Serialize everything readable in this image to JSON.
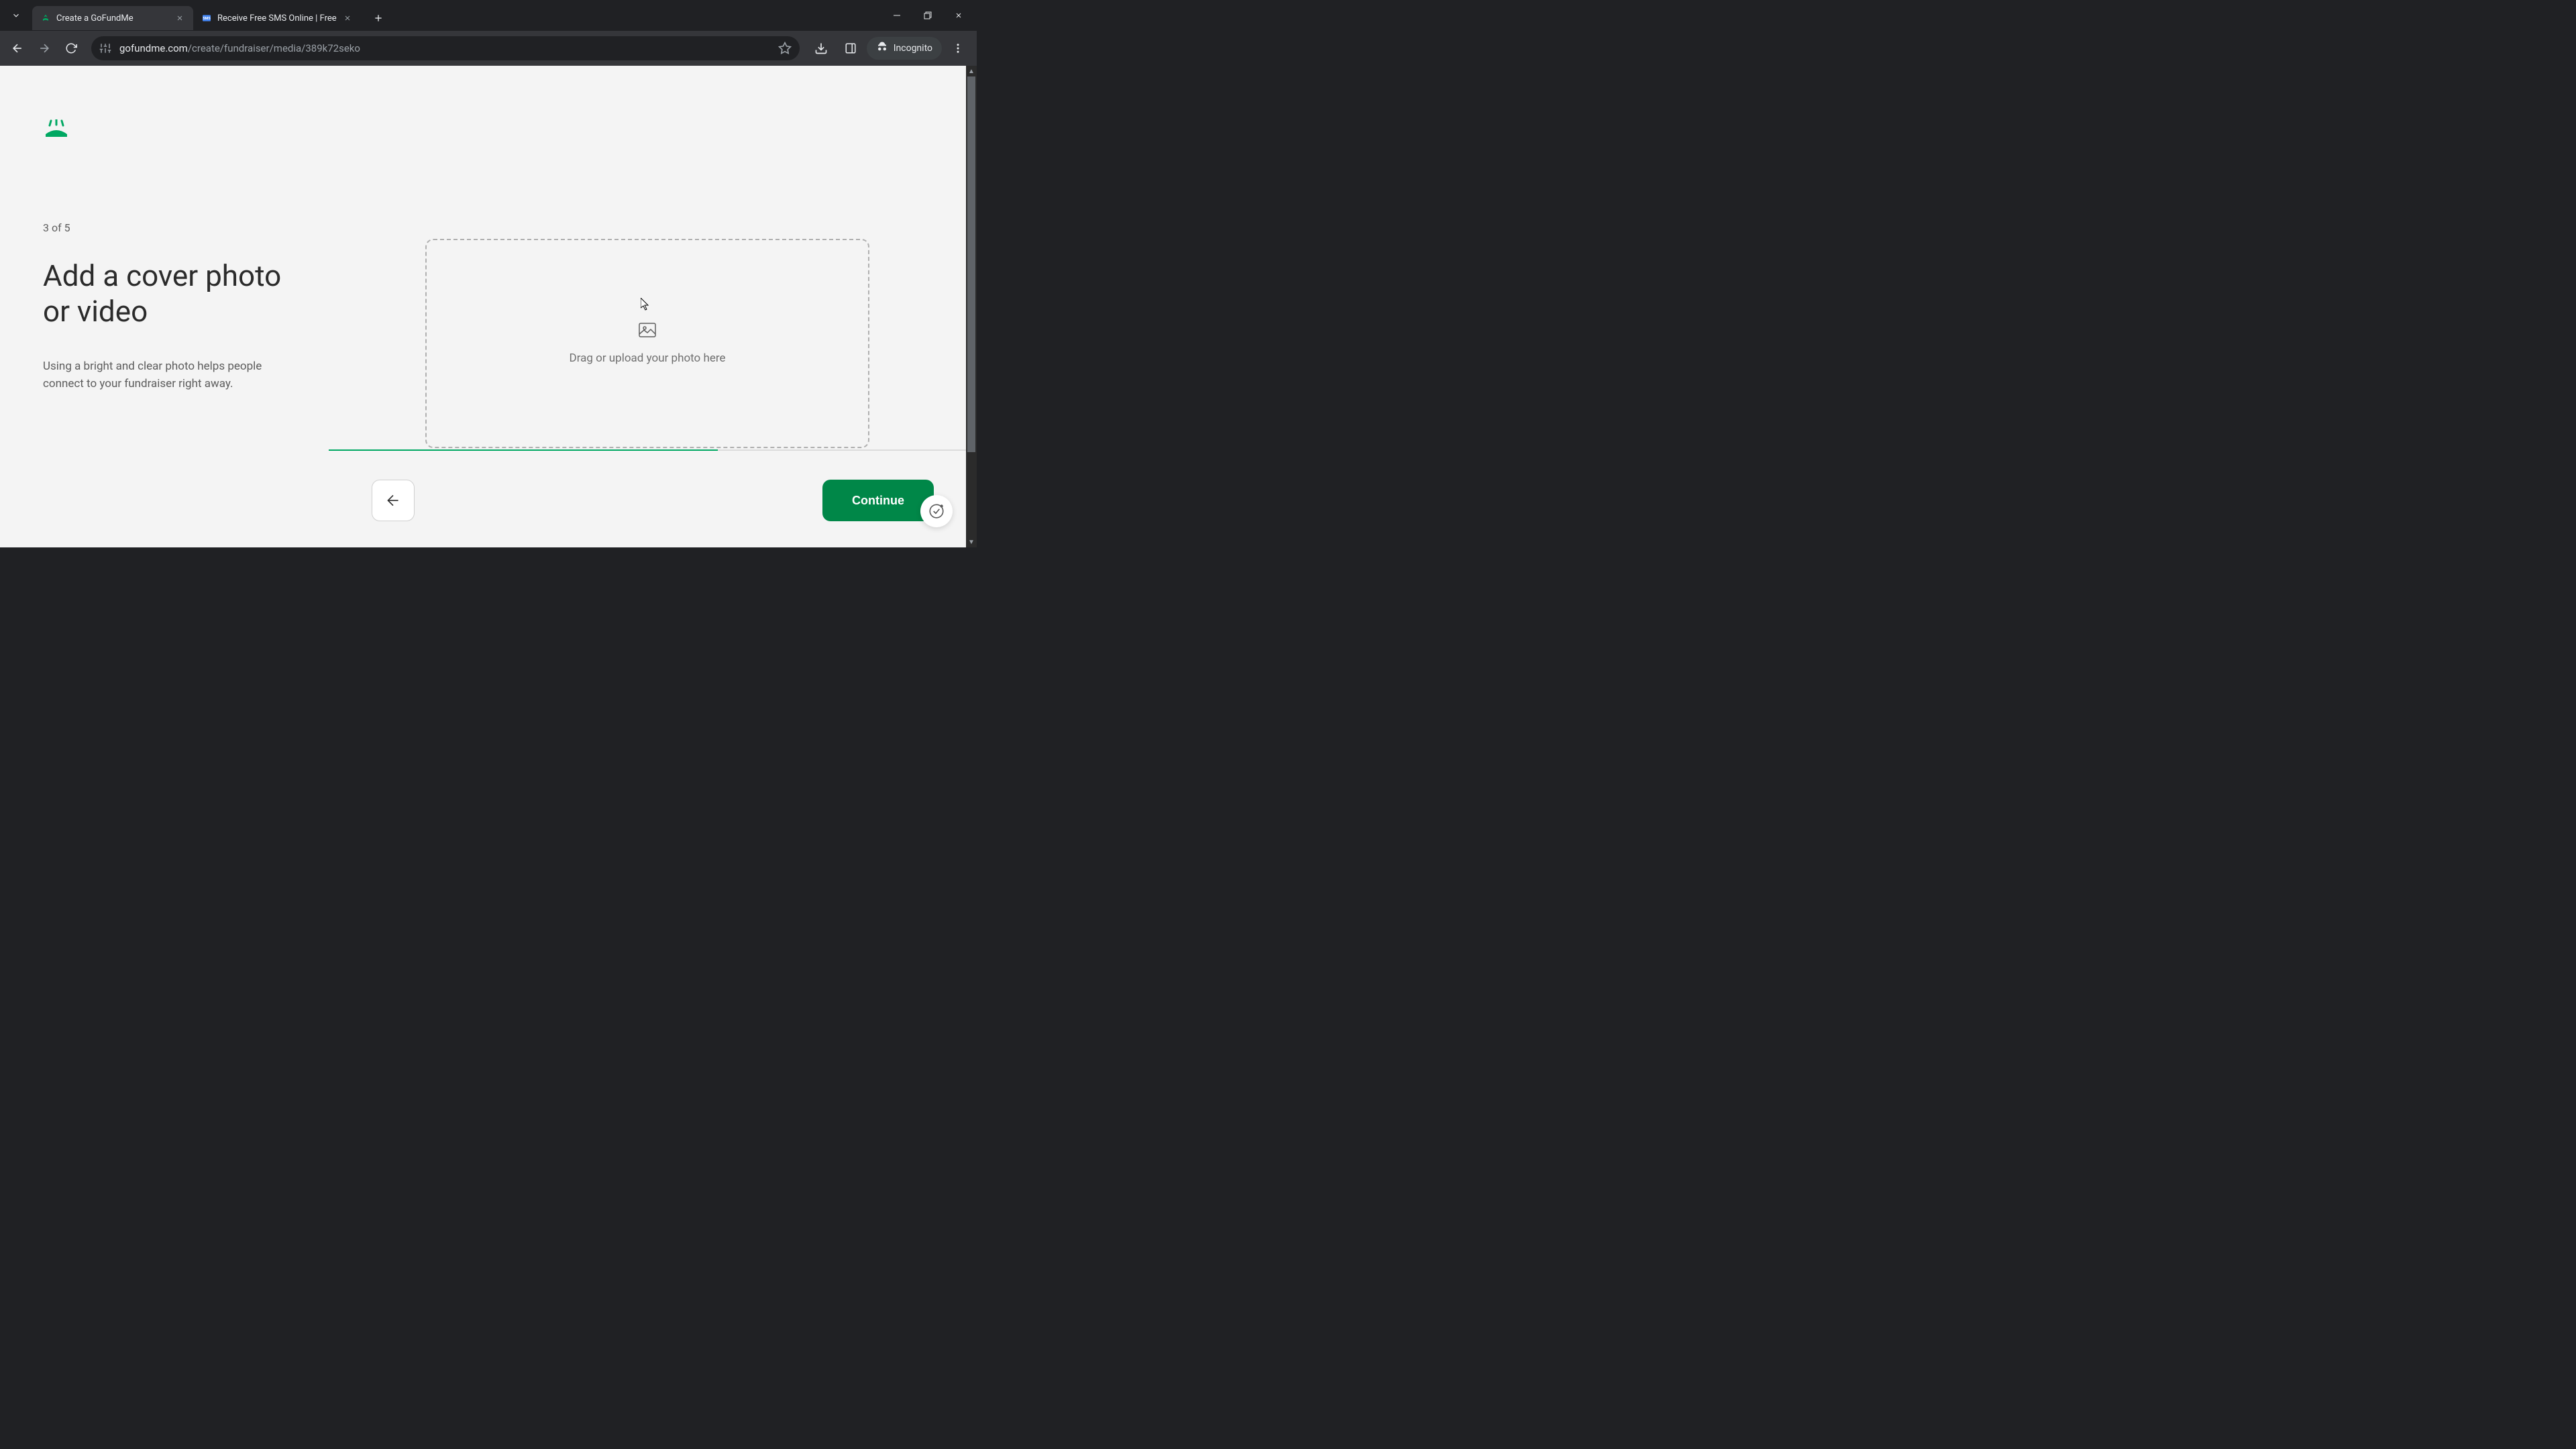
{
  "browser": {
    "tabs": [
      {
        "title": "Create a GoFundMe",
        "active": true
      },
      {
        "title": "Receive Free SMS Online | Free",
        "active": false
      }
    ],
    "url_domain": "gofundme.com",
    "url_path": "/create/fundraiser/media/389k72seko",
    "incognito_label": "Incognito"
  },
  "page": {
    "step_indicator": "3 of 5",
    "heading": "Add a cover photo or video",
    "description": "Using a bright and clear photo helps people connect to your fundraiser right away.",
    "dropzone_text": "Drag or upload your photo here",
    "continue_label": "Continue",
    "progress_percent": 60
  },
  "colors": {
    "brand_green": "#00a862",
    "button_green": "#008748"
  }
}
